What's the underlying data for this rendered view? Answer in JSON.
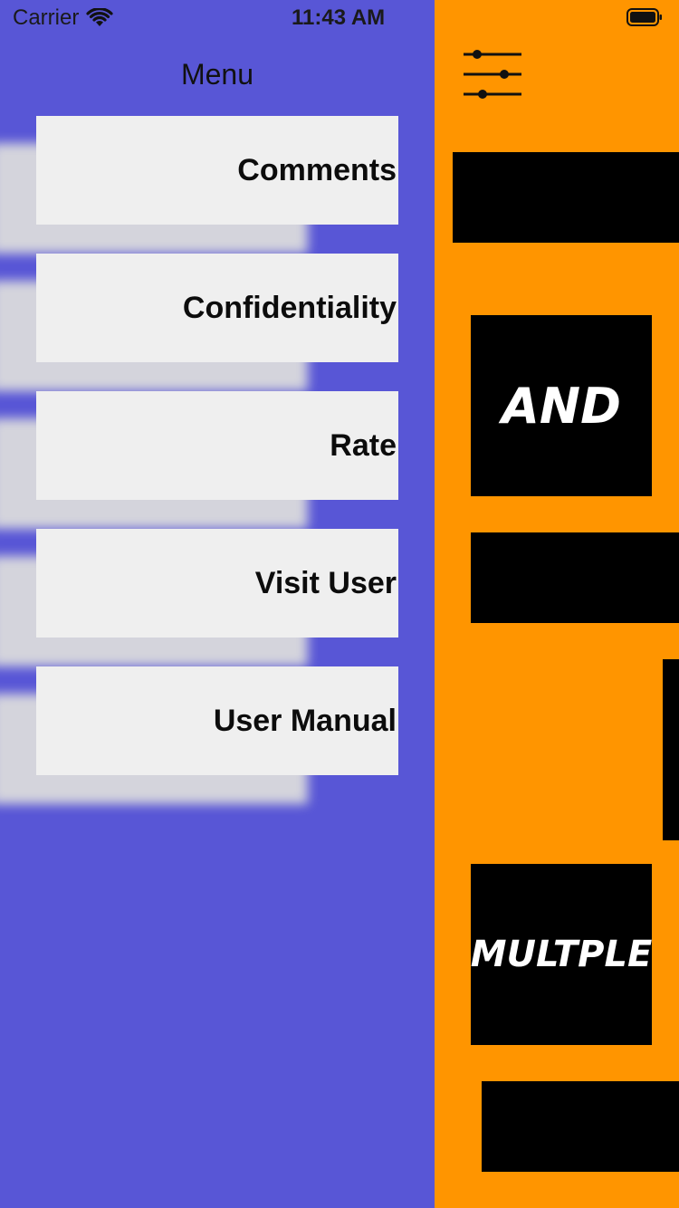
{
  "status_bar": {
    "carrier": "Carrier",
    "time": "11:43 AM",
    "wifi_icon": "wifi-icon",
    "battery_icon": "battery-icon"
  },
  "drawer": {
    "title": "Menu",
    "background": "#5856d6",
    "items": [
      {
        "label": "Comments"
      },
      {
        "label": "Confidentiality"
      },
      {
        "label": "Rate"
      },
      {
        "label": "Visit User"
      },
      {
        "label": "User Manual"
      }
    ]
  },
  "main": {
    "background": "#ff9500",
    "filter_icon": "sliders-icon",
    "tiles": [
      {
        "text": ""
      },
      {
        "text": "AND"
      },
      {
        "text": ""
      },
      {
        "text": ""
      },
      {
        "text": "MULTPLE"
      },
      {
        "text": ""
      }
    ]
  }
}
